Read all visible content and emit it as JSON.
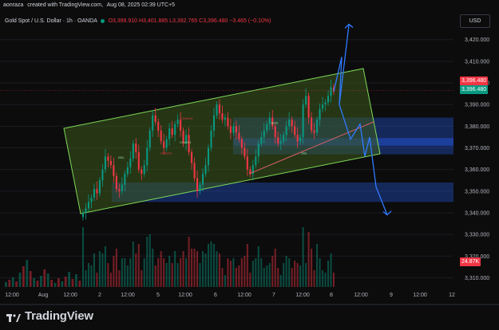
{
  "header": {
    "author": "aonraza",
    "created_text": "created with TradingView.com,",
    "date": "Aug 08, 2025 02:39 UTC+5"
  },
  "legend": {
    "title": "Gold Spot / U.S. Dollar · 1h · OANDA",
    "o": "O3,399.910",
    "h": "H3,401.885",
    "l": "L3,392.765",
    "c": "C3,396.480",
    "change": "−3.465 (−0.10%)"
  },
  "currency_button": "USD",
  "price_tags": {
    "last": "3,396.480",
    "last2": "3,396.480",
    "volume": "24.87K"
  },
  "colors": {
    "up": "#089981",
    "down": "#f23645",
    "channel_fill": "#3d5a1e",
    "channel_stroke": "#7ed957",
    "zone": "#2962ff",
    "arrow": "#2f7bff",
    "trend": "#e0606a"
  },
  "brand": "TradingView",
  "chart_data": {
    "type": "candlestick",
    "title": "Gold Spot / U.S. Dollar · 1h · OANDA",
    "y_range": [
      3305,
      3428
    ],
    "y_ticks": [
      "3,420.000",
      "3,410.000",
      "3,400.000",
      "3,390.000",
      "3,380.000",
      "3,370.000",
      "3,360.000",
      "3,350.000",
      "3,340.000",
      "3,330.000",
      "3,320.000",
      "3,310.000"
    ],
    "y_tick_values": [
      3420,
      3410,
      3400,
      3390,
      3380,
      3370,
      3360,
      3350,
      3340,
      3330,
      3320,
      3310
    ],
    "x_ticks": [
      "12:00",
      "Aug",
      "12:00",
      "2",
      "12:00",
      "5",
      "12:00",
      "6",
      "12:00",
      "7",
      "12:00",
      "8",
      "12:00",
      "9",
      "12:00",
      "12"
    ],
    "annotations": [
      "BSL",
      "CHoCH",
      "CHoCH",
      "CHoCH",
      "BOS",
      "SSL"
    ],
    "zones": [
      {
        "low": 3367,
        "high": 3384,
        "label": ""
      },
      {
        "low": 3345,
        "high": 3354,
        "label": ""
      }
    ],
    "projection_path_prices": [
      3396,
      3412,
      3390,
      3374,
      3381,
      3366,
      3375,
      3352,
      3339
    ],
    "projection_up_target": 3426,
    "closes": [
      3340,
      3342,
      3345,
      3347,
      3351,
      3349,
      3355,
      3360,
      3366,
      3364,
      3362,
      3357,
      3351,
      3350,
      3353,
      3358,
      3361,
      3365,
      3372,
      3368,
      3360,
      3358,
      3362,
      3370,
      3378,
      3385,
      3382,
      3378,
      3373,
      3370,
      3374,
      3379,
      3376,
      3381,
      3383,
      3378,
      3372,
      3376,
      3368,
      3363,
      3356,
      3350,
      3353,
      3358,
      3362,
      3370,
      3378,
      3385,
      3390,
      3386,
      3383,
      3384,
      3380,
      3377,
      3380,
      3377,
      3374,
      3370,
      3366,
      3360,
      3358,
      3362,
      3366,
      3372,
      3375,
      3378,
      3381,
      3384,
      3380,
      3375,
      3372,
      3373,
      3376,
      3380,
      3383,
      3380,
      3376,
      3373,
      3375,
      3390,
      3394,
      3384,
      3378,
      3377,
      3383,
      3388,
      3390,
      3391,
      3394,
      3398,
      3396
    ],
    "volume_unit": "K",
    "last_volume": 24.87
  }
}
